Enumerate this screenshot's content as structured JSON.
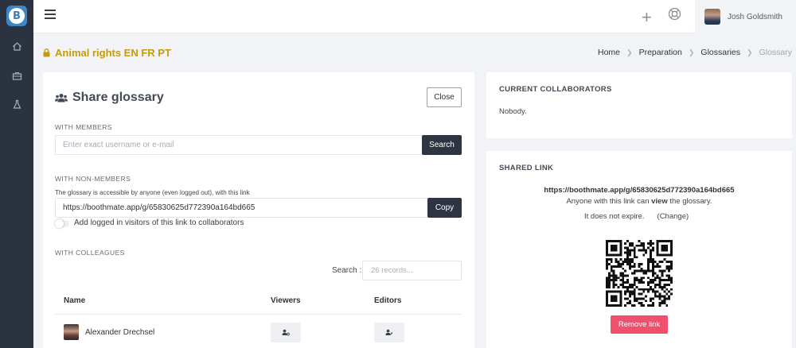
{
  "app": {
    "logo_letter": "B"
  },
  "user": {
    "name": "Josh Goldsmith"
  },
  "project": {
    "title": "Animal rights EN FR PT"
  },
  "breadcrumb": {
    "home": "Home",
    "preparation": "Preparation",
    "glossaries": "Glossaries",
    "current": "Glossary"
  },
  "share": {
    "title": "Share glossary",
    "close_label": "Close",
    "members_label": "WITH MEMBERS",
    "members_placeholder": "Enter exact username or e-mail",
    "search_button": "Search",
    "nonmembers_label": "WITH NON-MEMBERS",
    "nonmembers_help": "The glossary is accessible by anyone (even logged out), with this link",
    "link_value": "https://boothmate.app/g/65830625d772390a164bd665",
    "copy_button": "Copy",
    "toggle_label": "Add logged in visitors of this link to collaborators",
    "colleagues_label": "WITH COLLEAGUES",
    "search_label": "Search :",
    "search_placeholder": "26 records...",
    "table": {
      "headers": {
        "name": "Name",
        "viewers": "Viewers",
        "editors": "Editors"
      },
      "rows": [
        {
          "name": "Alexander Drechsel"
        }
      ]
    }
  },
  "collaborators": {
    "title": "CURRENT COLLABORATORS",
    "text": "Nobody."
  },
  "shared_link": {
    "title": "SHARED LINK",
    "url": "https://boothmate.app/g/65830625d772390a164bd665",
    "desc_before": "Anyone with this link can ",
    "desc_bold": "view",
    "desc_after": " the glossary.",
    "expire_text": "It does not expire.",
    "change_label": "(Change)",
    "remove_button": "Remove link"
  },
  "colors": {
    "accent_gold": "#c49a12",
    "sidebar": "#2c3340",
    "dark_button": "#2e3441",
    "danger": "#f0506e"
  }
}
